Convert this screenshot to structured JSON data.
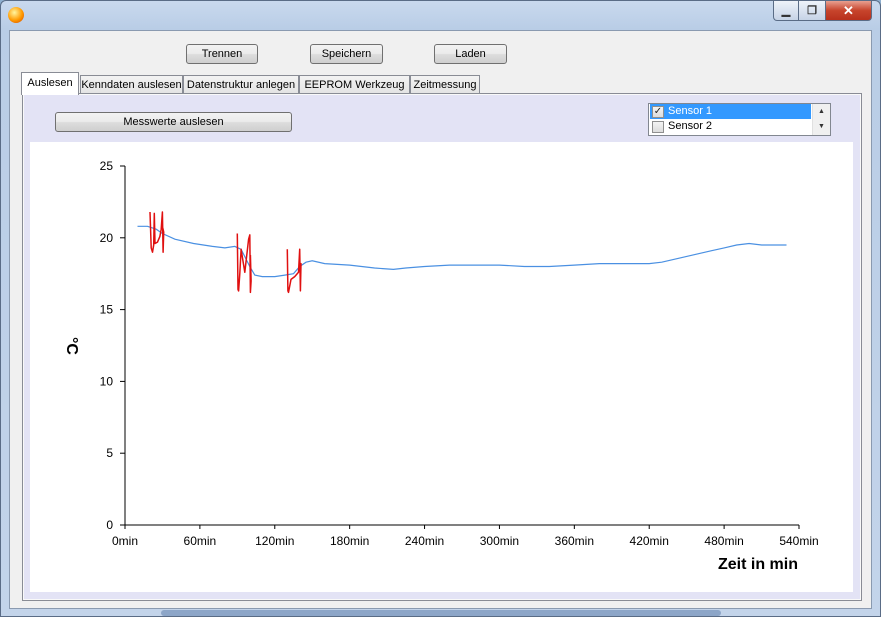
{
  "window": {
    "title": ""
  },
  "titlebar": {
    "minimize_glyph": "▁",
    "maximize_glyph": "❐",
    "close_glyph": "✕"
  },
  "toolbar": {
    "disconnect_label": "Trennen",
    "save_label": "Speichern",
    "load_label": "Laden"
  },
  "tabs": [
    {
      "label": "Auslesen",
      "active": true
    },
    {
      "label": "Kenndaten auslesen",
      "active": false
    },
    {
      "label": "Datenstruktur anlegen",
      "active": false
    },
    {
      "label": "EEPROM Werkzeug",
      "active": false
    },
    {
      "label": "Zeitmessung",
      "active": false
    }
  ],
  "read_button_label": "Messwerte auslesen",
  "sensor_list": {
    "items": [
      {
        "label": "Sensor 1",
        "checked": true,
        "selected": true
      },
      {
        "label": "Sensor 2",
        "checked": false,
        "selected": false
      }
    ],
    "scroll_up_glyph": "▲",
    "scroll_down_glyph": "▼"
  },
  "chart_data": {
    "type": "line",
    "xlabel": "Zeit in min",
    "ylabel": "°C",
    "xlim": [
      0,
      540
    ],
    "ylim": [
      0,
      25
    ],
    "x_ticks": [
      "0min",
      "60min",
      "120min",
      "180min",
      "240min",
      "300min",
      "360min",
      "420min",
      "480min",
      "540min"
    ],
    "y_ticks": [
      "0",
      "5",
      "10",
      "15",
      "20",
      "25"
    ],
    "grid": false,
    "series": [
      {
        "color": "#4a90e2",
        "x": [
          10,
          18,
          25,
          30,
          40,
          55,
          70,
          80,
          88,
          93,
          100,
          104,
          110,
          120,
          128,
          135,
          140,
          145,
          150,
          160,
          180,
          200,
          215,
          225,
          240,
          260,
          280,
          300,
          320,
          340,
          360,
          380,
          400,
          420,
          430,
          440,
          460,
          470,
          480,
          490,
          500,
          510,
          520,
          530
        ],
        "y": [
          20.8,
          20.8,
          20.6,
          20.3,
          19.9,
          19.6,
          19.4,
          19.3,
          19.4,
          19.2,
          18.0,
          17.4,
          17.3,
          17.3,
          17.4,
          17.5,
          18.0,
          18.3,
          18.4,
          18.2,
          18.1,
          17.9,
          17.8,
          17.9,
          18.0,
          18.1,
          18.1,
          18.1,
          18.0,
          18.0,
          18.1,
          18.2,
          18.2,
          18.2,
          18.3,
          18.5,
          18.9,
          19.1,
          19.3,
          19.5,
          19.6,
          19.5,
          19.5,
          19.5
        ]
      }
    ],
    "annotations": [
      {
        "type": "freehand",
        "color": "#e01010",
        "x": [
          20,
          21,
          22,
          23,
          23.5,
          24,
          26,
          28,
          29,
          30,
          30.5,
          31,
          30
        ],
        "y": [
          21.8,
          19.3,
          19.0,
          19.5,
          21.7,
          19.6,
          19.7,
          20.1,
          20.6,
          21.8,
          19.0,
          20.4,
          20.8
        ]
      },
      {
        "type": "freehand",
        "color": "#e01010",
        "x": [
          90,
          90.5,
          91,
          92,
          93,
          96,
          99,
          100,
          100.5,
          101,
          100.5
        ],
        "y": [
          20.3,
          16.4,
          16.3,
          17.5,
          19.2,
          17.6,
          19.9,
          20.2,
          16.2,
          17.0,
          18.8
        ]
      },
      {
        "type": "freehand",
        "color": "#e01010",
        "x": [
          130,
          130.5,
          131,
          133,
          136,
          139,
          140,
          140.5,
          141,
          140.5
        ],
        "y": [
          19.2,
          16.3,
          16.2,
          17.1,
          17.3,
          17.6,
          19.2,
          16.3,
          18.2,
          17.8
        ]
      }
    ]
  }
}
